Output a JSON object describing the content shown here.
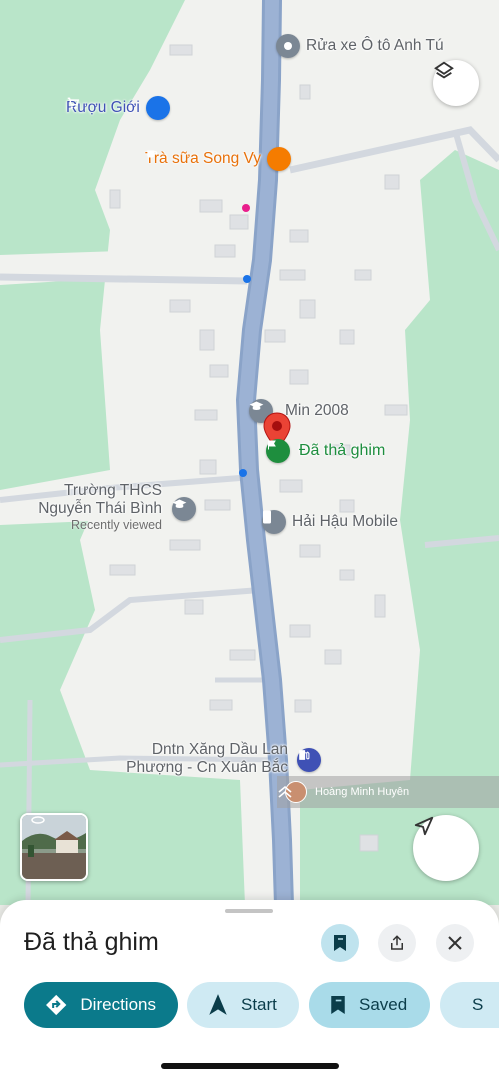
{
  "map": {
    "pois": [
      {
        "name": "Rửa xe Ô tô Anh Tú",
        "icon": "map-pin-icon"
      },
      {
        "name": "Rượu Giới",
        "icon": "shopping-cart-icon"
      },
      {
        "name": "Trà sữa Song Vy",
        "icon": "coffee-cup-icon"
      },
      {
        "name": "Min 2008",
        "icon": "school-icon"
      },
      {
        "name": "Đã thả ghim",
        "icon": "dropped-pin-icon"
      },
      {
        "name": "Trường THCS Nguyễn Thái Bình",
        "line1": "Trường THCS",
        "line2": "Nguyễn Thái Bình",
        "subtitle": "Recently viewed",
        "icon": "school-icon"
      },
      {
        "name": "Hải Hậu Mobile",
        "icon": "phone-shop-icon"
      },
      {
        "name": "Dntn Xăng Dầu Lan Phượng - Cn Xuân Bắc",
        "line1": "Dntn Xăng Dầu Lan",
        "line2": "Phượng - Cn Xuân Bắc",
        "icon": "gas-station-icon"
      }
    ],
    "street_view_author": "Hoàng Minh Huyên"
  },
  "sheet": {
    "title": "Đã thả ghim",
    "actions": [
      {
        "label": "Directions",
        "icon": "directions-icon"
      },
      {
        "label": "Start",
        "icon": "navigation-arrow-icon"
      },
      {
        "label": "Saved",
        "icon": "bookmark-icon"
      },
      {
        "label": "S",
        "icon": "share-icon"
      }
    ]
  },
  "colors": {
    "road": "#8fa6c9",
    "park": "#b8e6c8",
    "accent": "#0b7a8b",
    "pin": "#ea4335"
  }
}
